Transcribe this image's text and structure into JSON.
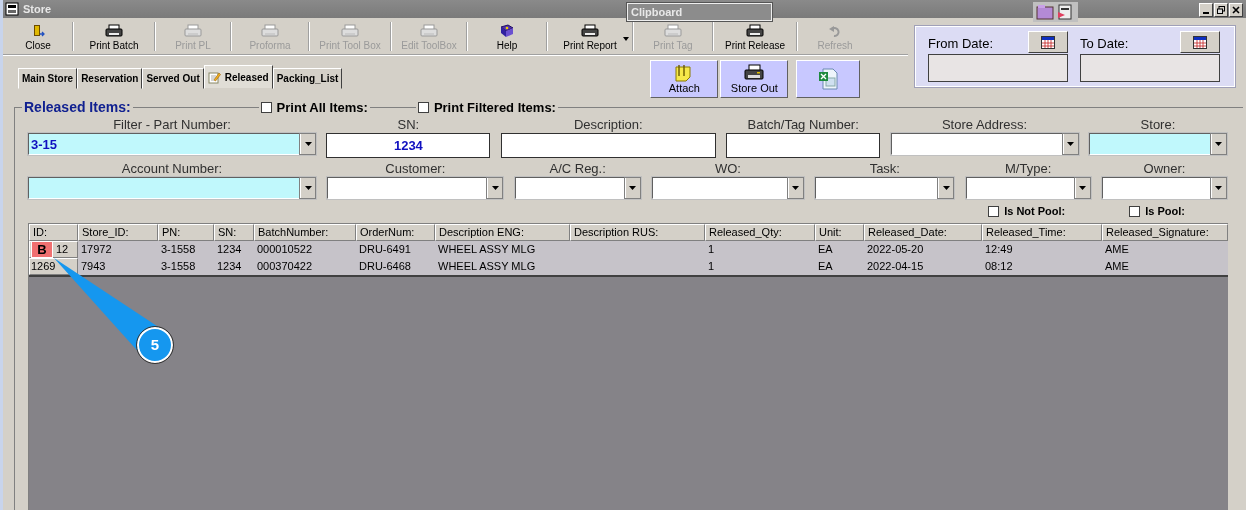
{
  "window": {
    "title": "Store"
  },
  "clipboard": {
    "title": "Clipboard"
  },
  "toolbar": [
    {
      "label": "Close",
      "disabled": false
    },
    {
      "label": "Print Batch",
      "disabled": false
    },
    {
      "label": "Print PL",
      "disabled": true
    },
    {
      "label": "Proforma",
      "disabled": true
    },
    {
      "label": "Print Tool Box",
      "disabled": true
    },
    {
      "label": "Edit ToolBox",
      "disabled": true
    },
    {
      "label": "Help",
      "disabled": false
    },
    {
      "label": "Print Report",
      "disabled": false
    },
    {
      "label": "Print Tag",
      "disabled": true
    },
    {
      "label": "Print Release",
      "disabled": false
    },
    {
      "label": "Refresh",
      "disabled": true
    }
  ],
  "date_range": {
    "from_label": "From Date:",
    "to_label": "To Date:"
  },
  "tabs": [
    {
      "label": "Main Store",
      "selected": false
    },
    {
      "label": "Reservation",
      "selected": false
    },
    {
      "label": "Served Out",
      "selected": false
    },
    {
      "label": "Released",
      "selected": true
    },
    {
      "label": "Packing_List",
      "selected": false
    }
  ],
  "actions": [
    "Attach",
    "Store Out"
  ],
  "group": {
    "title": "Released Items:"
  },
  "print_options": [
    {
      "label": "Print All Items:",
      "checked": false
    },
    {
      "label": "Print Filtered Items:",
      "checked": false
    }
  ],
  "filters_row_1": [
    {
      "label": "Filter - Part Number:",
      "kind": "combo",
      "highlighted": true,
      "value": "3-15"
    },
    {
      "label": "SN:",
      "kind": "text",
      "highlighted": false,
      "value": "1234"
    },
    {
      "label": "Description:",
      "kind": "text",
      "highlighted": false
    },
    {
      "label": "Batch/Tag Number:",
      "kind": "text",
      "highlighted": false
    },
    {
      "label": "Store Address:",
      "kind": "combo",
      "highlighted": false
    },
    {
      "label": "Store:",
      "kind": "combo",
      "highlighted": true
    }
  ],
  "filters_row_2": [
    {
      "label": "Account Number:",
      "kind": "combo",
      "highlighted": true
    },
    {
      "label": "Customer:",
      "kind": "combo",
      "highlighted": false
    },
    {
      "label": "A/C Reg.:",
      "kind": "combo",
      "highlighted": false
    },
    {
      "label": "WO:",
      "kind": "combo",
      "highlighted": false
    },
    {
      "label": "Task:",
      "kind": "combo",
      "highlighted": false
    },
    {
      "label": "M/Type:",
      "kind": "combo",
      "highlighted": false
    },
    {
      "label": "Owner:",
      "kind": "combo",
      "highlighted": false
    }
  ],
  "pool_options": [
    {
      "label": "Is Not Pool:",
      "checked": false
    },
    {
      "label": "Is Pool:",
      "checked": false
    }
  ],
  "table": {
    "columns": [
      "ID:",
      "Store_ID:",
      "PN:",
      "SN:",
      "BatchNumber:",
      "OrderNum:",
      "Description ENG:",
      "Description RUS:",
      "Released_Qty:",
      "Unit:",
      "Released_Date:",
      "Released_Time:",
      "Released_Signature:"
    ],
    "rows": [
      [
        "12",
        "17972",
        "3-1558",
        "1234",
        "000010522",
        "DRU-6491",
        "WHEEL ASSY MLG",
        "",
        "1",
        "EA",
        "2022-05-20",
        "12:49",
        "AME"
      ],
      [
        "1269",
        "7943",
        "3-1558",
        "1234",
        "000370422",
        "DRU-6468",
        "WHEEL ASSY MLG",
        "",
        "1",
        "EA",
        "2022-04-15",
        "08:12",
        "AME"
      ]
    ]
  },
  "annotations": {
    "badge": "B",
    "callout": "5"
  }
}
